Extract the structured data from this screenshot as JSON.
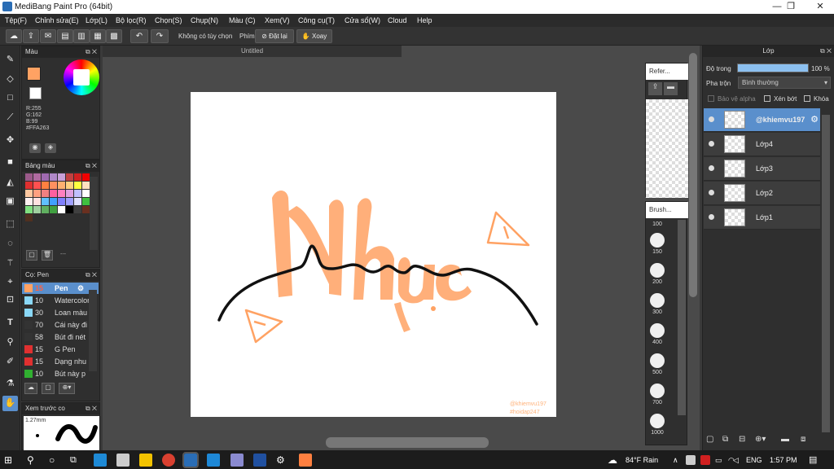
{
  "window": {
    "title": "MediBang Paint Pro (64bit)"
  },
  "menu": [
    "Tệp(F)",
    "Chỉnh sửa(E)",
    "Lớp(L)",
    "Bộ lọc(R)",
    "Chọn(S)",
    "Chụp(N)",
    "Màu (C)",
    "Xem(V)",
    "Công cụ(T)",
    "Cửa sổ(W)",
    "Cloud",
    "Help"
  ],
  "toolbar": {
    "no_option": "Không có tùy chọn",
    "key_label": "Phím",
    "reset_label": "Đặt lại",
    "rotate_label": "Xoay"
  },
  "color_panel": {
    "title": "Màu",
    "r": "R:255",
    "g": "G:162",
    "b": "B:99",
    "hex": "#FFA263",
    "fg_color": "#FFA263"
  },
  "palette_panel": {
    "title": "Bảng màu",
    "extra": "---",
    "colors": [
      "#9b5a8a",
      "#b06aa0",
      "#a06ab0",
      "#b088c8",
      "#c8a0d8",
      "#c04040",
      "#d02020",
      "#f00000",
      "#e03030",
      "#ff5050",
      "#ff8040",
      "#ff9060",
      "#ffb070",
      "#ffd080",
      "#ffff40",
      "#ffe0c0",
      "#ffc8a0",
      "#ffa080",
      "#f08080",
      "#ff60a0",
      "#ff80c0",
      "#e0a0e0",
      "#c0c0ff",
      "#ffffff",
      "#fff0f0",
      "#ffe0e0",
      "#60c0ff",
      "#40a0ff",
      "#8080ff",
      "#a0a0ff",
      "#e0e0ff",
      "#40c040",
      "#80e080",
      "#a0d0a0",
      "#60b060",
      "#40a040",
      "#ffffff",
      "#000000",
      "#404040",
      "#6a3020",
      "#503020"
    ]
  },
  "brush_panel": {
    "title": "Cọ: Pen",
    "items": [
      {
        "size": "15",
        "name": "Pen",
        "color": "#ffa263"
      },
      {
        "size": "10",
        "name": "Watercolor",
        "color": "#8ad8f8"
      },
      {
        "size": "30",
        "name": "Loan màu",
        "color": "#8ad8f8"
      },
      {
        "size": "70",
        "name": "Cái này đi",
        "color": "#333333"
      },
      {
        "size": "58",
        "name": "Bút đi nét",
        "color": "#333333"
      },
      {
        "size": "15",
        "name": "G Pen",
        "color": "#e03030"
      },
      {
        "size": "15",
        "name": "Dạng nhu",
        "color": "#e03030"
      },
      {
        "size": "10",
        "name": "Bút này p",
        "color": "#30b030"
      }
    ]
  },
  "preview_panel": {
    "title": "Xem trước co",
    "size": "1.27mm"
  },
  "document": {
    "tab": "Untitled",
    "watermark_line1": "@khiemvu197",
    "watermark_line2": "#hoidap247"
  },
  "ref_panel": {
    "title": "Refer..."
  },
  "brush_size_panel": {
    "title": "Brush...",
    "sizes": [
      "100",
      "150",
      "200",
      "300",
      "400",
      "500",
      "700",
      "1000"
    ]
  },
  "layer_panel": {
    "title": "Lớp",
    "opacity_label": "Độ trong",
    "opacity_value": "100 %",
    "opacity_fraction": 1.0,
    "blend_label": "Pha trộn",
    "blend_value": "Bình thường",
    "protect_alpha": "Bảo vệ alpha",
    "clip": "Xén bớt",
    "lock": "Khóa",
    "layers": [
      "@khiemvu197",
      "Lớp4",
      "Lớp3",
      "Lớp2",
      "Lớp1"
    ]
  },
  "taskbar": {
    "weather": "84°F Rain",
    "lang": "ENG",
    "time": "1:57 PM"
  }
}
